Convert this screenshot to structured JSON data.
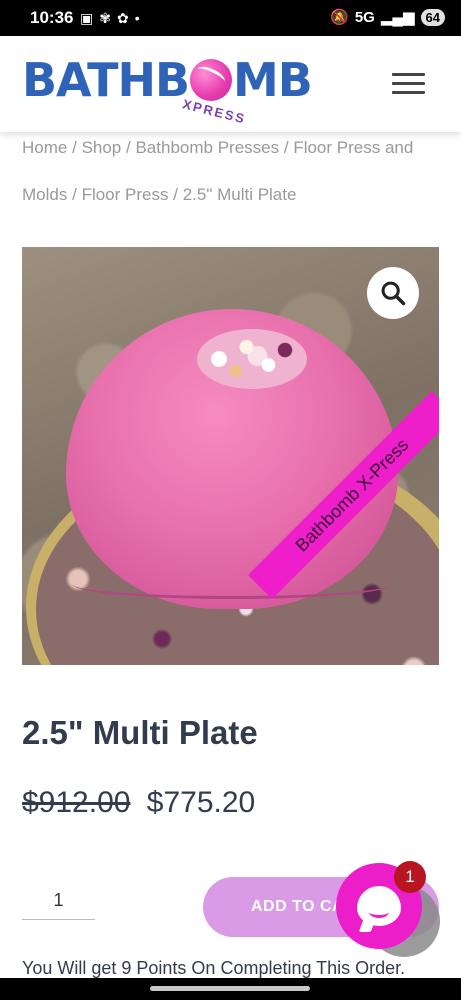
{
  "status_bar": {
    "time": "10:36",
    "network": "5G",
    "battery": "64"
  },
  "header": {
    "logo_text_left": "BATHB",
    "logo_text_right": "MB",
    "logo_sub": "XPRESS",
    "menu_icon": "hamburger-menu-icon"
  },
  "breadcrumb": {
    "items": [
      "Home",
      "Shop",
      "Bathbomb Presses",
      "Floor Press and Molds",
      "Floor Press"
    ],
    "current": "2.5\" Multi Plate",
    "separator": "/"
  },
  "product": {
    "image_watermark": "Bathbomb X-Press",
    "zoom_icon": "magnifier-icon",
    "title": "2.5\" Multi Plate",
    "price_old": "$912.00",
    "price_new": "$775.20",
    "quantity": "1",
    "add_to_cart_label": "ADD TO CART",
    "points_text": "You Will get 9 Points On Completing This Order."
  },
  "chat": {
    "icon": "chat-bubble-icon",
    "badge_count": "1",
    "color": "#ec1ec9"
  },
  "colors": {
    "brand_blue": "#2e63b8",
    "brand_pink": "#ec1ec9",
    "button_lilac": "#d99be6",
    "text_dark": "#333c4e"
  }
}
